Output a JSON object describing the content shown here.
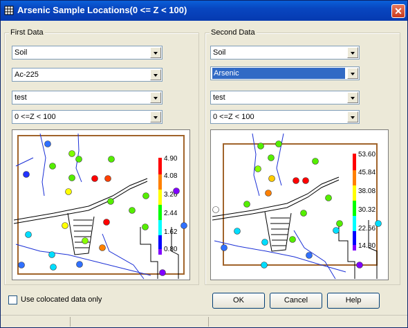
{
  "window": {
    "title": "Arsenic Sample Locations(0 <= Z < 100)",
    "close_glyph": "✕"
  },
  "first": {
    "label": "First Data",
    "combos": [
      "Soil",
      "Ac-225",
      "test",
      "0 <=Z < 100"
    ],
    "legend_ticks": [
      "4.90",
      "4.08",
      "3.26",
      "2.44",
      "1.62",
      "0.80"
    ]
  },
  "second": {
    "label": "Second Data",
    "combos": [
      "Soil",
      "Arsenic",
      "test",
      "0 <=Z < 100"
    ],
    "legend_ticks": [
      "53.60",
      "45.84",
      "38.08",
      "30.32",
      "22.56",
      "14.80"
    ]
  },
  "colocated_label": "Use colocated data only",
  "buttons": {
    "ok": "OK",
    "cancel": "Cancel",
    "help": "Help"
  },
  "colors": {
    "title_bar": "#0846c0",
    "selection": "#316ac5",
    "boundary": "#a0632a",
    "river": "#1a2fd6",
    "road": "#000000"
  }
}
